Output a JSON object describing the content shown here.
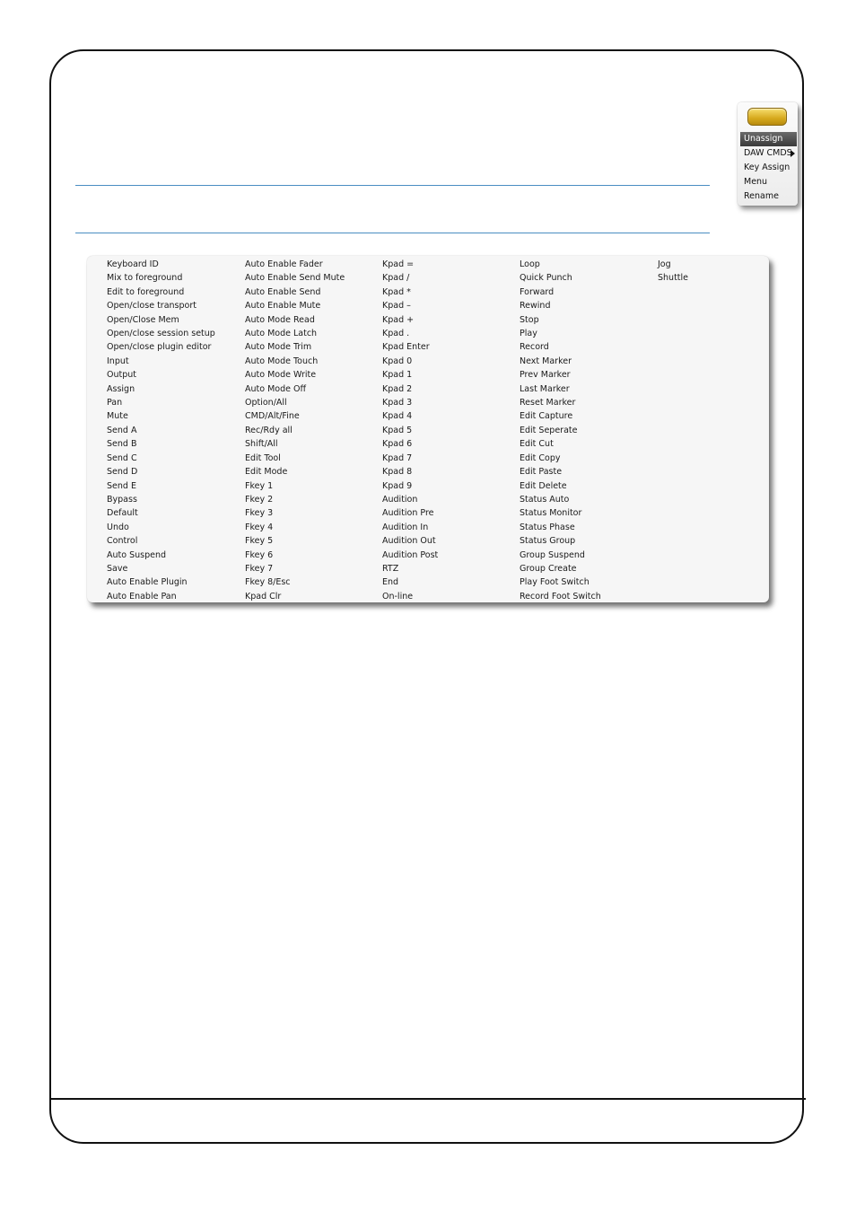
{
  "popup_menu": {
    "items": [
      {
        "label": "Unassign",
        "selected": true,
        "submenu": false
      },
      {
        "label": "DAW CMDS",
        "selected": false,
        "submenu": true
      },
      {
        "label": "Key Assign",
        "selected": false,
        "submenu": false
      },
      {
        "label": "Menu",
        "selected": false,
        "submenu": false
      },
      {
        "label": "Rename",
        "selected": false,
        "submenu": false
      }
    ]
  },
  "command_table": {
    "columns": [
      [
        "Keyboard ID",
        "Mix to foreground",
        "Edit to foreground",
        "Open/close transport",
        "Open/Close Mem",
        "Open/close session setup",
        "Open/close plugin editor",
        "Input",
        "Output",
        "Assign",
        "Pan",
        "Mute",
        "Send A",
        "Send B",
        "Send C",
        "Send D",
        "Send E",
        "Bypass",
        "Default",
        "Undo",
        "Control",
        "Auto Suspend",
        "Save",
        "Auto Enable Plugin",
        "Auto Enable Pan"
      ],
      [
        "Auto Enable Fader",
        "Auto Enable Send Mute",
        "Auto Enable Send",
        "Auto Enable Mute",
        "Auto Mode Read",
        "Auto Mode Latch",
        "Auto Mode Trim",
        "Auto Mode Touch",
        "Auto Mode Write",
        "Auto Mode Off",
        "Option/All",
        "CMD/Alt/Fine",
        "Rec/Rdy all",
        "Shift/All",
        "Edit Tool",
        "Edit Mode",
        "Fkey 1",
        "Fkey 2",
        "Fkey 3",
        "Fkey 4",
        "Fkey 5",
        "Fkey 6",
        "Fkey 7",
        "Fkey 8/Esc",
        "Kpad Clr"
      ],
      [
        "Kpad =",
        "Kpad /",
        "Kpad *",
        "Kpad –",
        "Kpad +",
        "Kpad .",
        "Kpad Enter",
        "Kpad 0",
        "Kpad 1",
        "Kpad 2",
        "Kpad 3",
        "Kpad 4",
        "Kpad 5",
        "Kpad 6",
        "Kpad 7",
        "Kpad 8",
        "Kpad 9",
        "Audition",
        "Audition Pre",
        "Audition In",
        "Audition Out",
        "Audition Post",
        "RTZ",
        "End",
        "On-line"
      ],
      [
        "Loop",
        "Quick Punch",
        "Forward",
        "Rewind",
        "Stop",
        "Play",
        "Record",
        "Next Marker",
        "Prev Marker",
        "Last Marker",
        "Reset Marker",
        "Edit Capture",
        "Edit Seperate",
        "Edit Cut",
        "Edit Copy",
        "Edit Paste",
        "Edit Delete",
        "Status Auto",
        "Status Monitor",
        "Status Phase",
        "Status Group",
        "Group Suspend",
        "Group Create",
        "Play Foot Switch",
        "Record Foot Switch"
      ],
      [
        "Jog",
        "Shuttle"
      ]
    ]
  },
  "colors": {
    "rule_blue": "#4a8ec2",
    "frame": "#111111",
    "key_gold": "#e2bd3a",
    "menu_selected": "#4a4a4a"
  }
}
